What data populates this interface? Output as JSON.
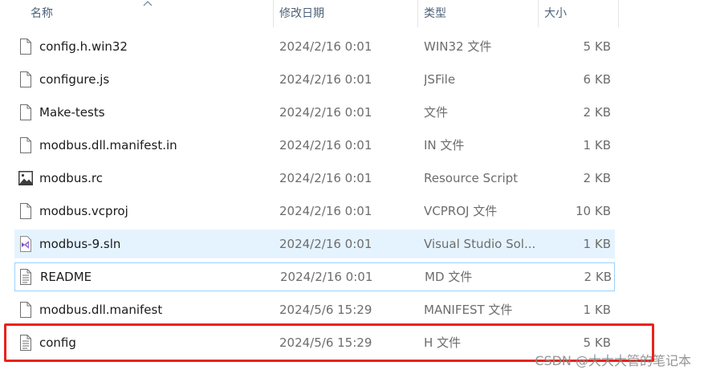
{
  "columns": {
    "name": "名称",
    "date": "修改日期",
    "type": "类型",
    "size": "大小"
  },
  "files": [
    {
      "name": "config.h.win32",
      "date": "2024/2/16 0:01",
      "type": "WIN32 文件",
      "size": "5 KB",
      "icon": "blank-file-icon"
    },
    {
      "name": "configure.js",
      "date": "2024/2/16 0:01",
      "type": "JSFile",
      "size": "6 KB",
      "icon": "blank-file-icon"
    },
    {
      "name": "Make-tests",
      "date": "2024/2/16 0:01",
      "type": "文件",
      "size": "2 KB",
      "icon": "blank-file-icon"
    },
    {
      "name": "modbus.dll.manifest.in",
      "date": "2024/2/16 0:01",
      "type": "IN 文件",
      "size": "1 KB",
      "icon": "blank-file-icon"
    },
    {
      "name": "modbus.rc",
      "date": "2024/2/16 0:01",
      "type": "Resource Script",
      "size": "2 KB",
      "icon": "image-file-icon"
    },
    {
      "name": "modbus.vcproj",
      "date": "2024/2/16 0:01",
      "type": "VCPROJ 文件",
      "size": "10 KB",
      "icon": "blank-file-icon"
    },
    {
      "name": "modbus-9.sln",
      "date": "2024/2/16 0:01",
      "type": "Visual Studio Sol...",
      "size": "1 KB",
      "icon": "visual-studio-icon"
    },
    {
      "name": "README",
      "date": "2024/2/16 0:01",
      "type": "MD 文件",
      "size": "2 KB",
      "icon": "text-file-icon"
    },
    {
      "name": "modbus.dll.manifest",
      "date": "2024/5/6 15:29",
      "type": "MANIFEST 文件",
      "size": "1 KB",
      "icon": "blank-file-icon"
    },
    {
      "name": "config",
      "date": "2024/5/6 15:29",
      "type": "H 文件",
      "size": "5 KB",
      "icon": "text-file-icon"
    }
  ],
  "watermark": "CSDN @大大大管的笔记本",
  "colors": {
    "hover": "#e5f3ff",
    "selected_border": "#99d1ff",
    "highlight": "#e8231b"
  }
}
